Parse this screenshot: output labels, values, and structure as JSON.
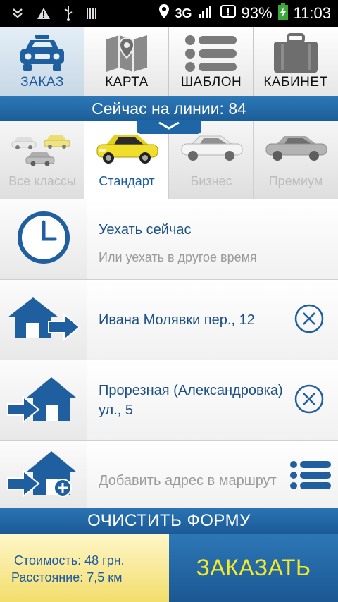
{
  "statusbar": {
    "network": "3G",
    "battery": "93%",
    "time": "11:03"
  },
  "nav": {
    "tabs": [
      {
        "label": "ЗАКАЗ",
        "icon": "taxi-car-icon",
        "active": true
      },
      {
        "label": "КАРТА",
        "icon": "map-icon",
        "active": false
      },
      {
        "label": "ШАБЛОН",
        "icon": "list-icon",
        "active": false
      },
      {
        "label": "КАБИНЕТ",
        "icon": "briefcase-icon",
        "active": false
      }
    ]
  },
  "online": {
    "text": "Сейчас на линии: 84"
  },
  "classes": [
    {
      "label": "Все классы",
      "icon": "multiple-cars-image",
      "active": false
    },
    {
      "label": "Стандарт",
      "icon": "yellow-car-image",
      "active": true
    },
    {
      "label": "Бизнес",
      "icon": "white-sedan-image",
      "active": false
    },
    {
      "label": "Премиум",
      "icon": "gray-sedan-image",
      "active": false
    }
  ],
  "form": {
    "time": {
      "title": "Уехать сейчас",
      "subtitle": "Или уехать в другое время"
    },
    "from": {
      "address": "Ивана Молявки пер., 12"
    },
    "to": {
      "address_line1": "Прорезная (Александровка)",
      "address_line2": "ул., 5"
    },
    "add": {
      "placeholder": "Добавить адрес в маршрут"
    }
  },
  "clear_form_label": "ОЧИСТИТЬ ФОРМУ",
  "summary": {
    "cost": "Стоимость: 48 грн.",
    "distance": "Расстояние: 7,5 км"
  },
  "order_label": "ЗАКАЗАТЬ",
  "colors": {
    "accent": "#1b5aa0",
    "order_text": "#f5ea2a",
    "price_bg": "#f2dd6b"
  }
}
